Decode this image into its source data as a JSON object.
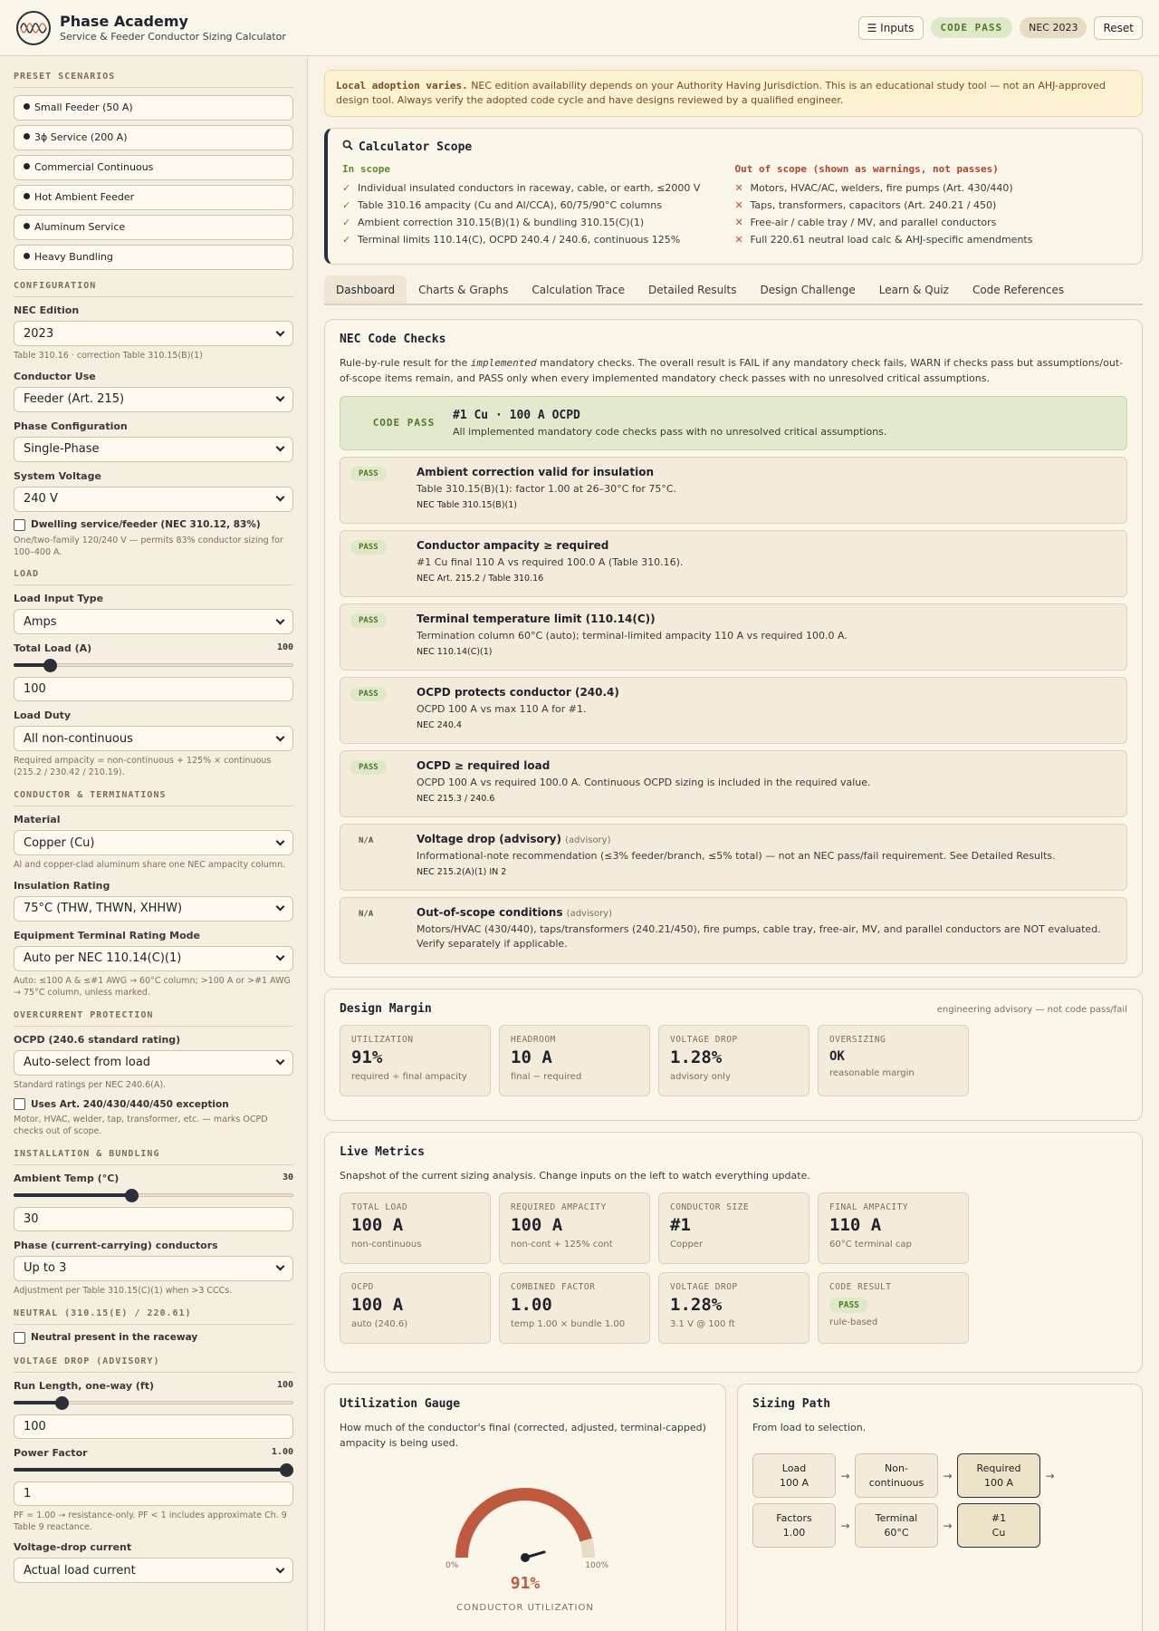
{
  "header": {
    "title": "Phase Academy",
    "subtitle": "Service & Feeder Conductor Sizing Calculator",
    "inputs_btn": "☰ Inputs",
    "code_pass": "CODE PASS",
    "nec": "NEC 2023",
    "reset": "Reset"
  },
  "sidebar": {
    "presets_h": "PRESET SCENARIOS",
    "presets": [
      "Small Feeder (50 A)",
      "3ϕ Service (200 A)",
      "Commercial Continuous",
      "Hot Ambient Feeder",
      "Aluminum Service",
      "Heavy Bundling"
    ],
    "config_h": "CONFIGURATION",
    "nec_edition_l": "NEC Edition",
    "nec_edition_v": "2023",
    "nec_edition_hint": "Table 310.16 · correction Table 310.15(B)(1)",
    "conductor_use_l": "Conductor Use",
    "conductor_use_v": "Feeder (Art. 215)",
    "phase_l": "Phase Configuration",
    "phase_v": "Single-Phase",
    "voltage_l": "System Voltage",
    "voltage_v": "240 V",
    "dwelling_l": "Dwelling service/feeder (NEC 310.12, 83%)",
    "dwelling_hint": "One/two-family 120/240 V — permits 83% conductor sizing for 100–400 A.",
    "load_h": "LOAD",
    "load_type_l": "Load Input Type",
    "load_type_v": "Amps",
    "total_load_l": "Total Load (A)",
    "total_load_val": "100",
    "total_load_slider": 0.13,
    "total_load_input": "100",
    "load_duty_l": "Load Duty",
    "load_duty_v": "All non-continuous",
    "load_duty_hint": "Required ampacity = non-continuous + 125% × continuous (215.2 / 230.42 / 210.19).",
    "cond_h": "CONDUCTOR & TERMINATIONS",
    "material_l": "Material",
    "material_v": "Copper (Cu)",
    "material_hint": "Al and copper-clad aluminum share one NEC ampacity column.",
    "insulation_l": "Insulation Rating",
    "insulation_v": "75°C (THW, THWN, XHHW)",
    "terminal_l": "Equipment Terminal Rating Mode",
    "terminal_v": "Auto per NEC 110.14(C)(1)",
    "terminal_hint": "Auto: ≤100 A & ≤#1 AWG → 60°C column; >100 A or >#1 AWG → 75°C column, unless marked.",
    "ocp_h": "OVERCURRENT PROTECTION",
    "ocpd_l": "OCPD (240.6 standard rating)",
    "ocpd_v": "Auto-select from load",
    "ocpd_hint": "Standard ratings per NEC 240.6(A).",
    "exception_l": "Uses Art. 240/430/440/450 exception",
    "exception_hint": "Motor, HVAC, welder, tap, transformer, etc. — marks OCPD checks out of scope.",
    "install_h": "INSTALLATION & BUNDLING",
    "ambient_l": "Ambient Temp (°C)",
    "ambient_val": "30",
    "ambient_slider": 0.42,
    "ambient_input": "30",
    "ccc_l": "Phase (current-carrying) conductors",
    "ccc_v": "Up to 3",
    "ccc_hint": "Adjustment per Table 310.15(C)(1) when >3 CCCs.",
    "neutral_h": "NEUTRAL (310.15(E) / 220.61)",
    "neutral_l": "Neutral present in the raceway",
    "vd_h": "VOLTAGE DROP (ADVISORY)",
    "run_l": "Run Length, one-way (ft)",
    "run_val": "100",
    "run_slider": 0.17,
    "run_input": "100",
    "pf_l": "Power Factor",
    "pf_val": "1.00",
    "pf_slider": 1.0,
    "pf_input": "1",
    "pf_hint": "PF = 1.00 → resistance-only. PF < 1 includes approximate Ch. 9 Table 9 reactance.",
    "vdc_l": "Voltage-drop current",
    "vdc_v": "Actual load current"
  },
  "banner": {
    "lead": "Local adoption varies.",
    "text": " NEC edition availability depends on your Authority Having Jurisdiction. This is an educational study tool — not an AHJ-approved design tool. Always verify the adopted code cycle and have designs reviewed by a qualified engineer."
  },
  "scope": {
    "title": "Calculator Scope",
    "in_h": "In scope",
    "in": [
      "Individual insulated conductors in raceway, cable, or earth, ≤2000 V",
      "Table 310.16 ampacity (Cu and Al/CCA), 60/75/90°C columns",
      "Ambient correction 310.15(B)(1) & bundling 310.15(C)(1)",
      "Terminal limits 110.14(C), OCPD 240.4 / 240.6, continuous 125%"
    ],
    "out_h": "Out of scope (shown as warnings, not passes)",
    "out": [
      "Motors, HVAC/AC, welders, fire pumps (Art. 430/440)",
      "Taps, transformers, capacitors (Art. 240.21 / 450)",
      "Free-air / cable tray / MV, and parallel conductors",
      "Full 220.61 neutral load calc & AHJ-specific amendments"
    ],
    "check": "✓",
    "cross": "✕"
  },
  "tabs": [
    "Dashboard",
    "Charts & Graphs",
    "Calculation Trace",
    "Detailed Results",
    "Design Challenge",
    "Learn & Quiz",
    "Code References"
  ],
  "checks": {
    "title": "NEC Code Checks",
    "desc_a": "Rule-by-rule result for the ",
    "desc_em": "implemented",
    "desc_b": " mandatory checks. The overall result is FAIL if any mandatory check fails, WARN if checks pass but assumptions/out-of-scope items remain, and PASS only when every implemented mandatory check passes with no unresolved critical assumptions.",
    "overall_tag": "CODE PASS",
    "overall_t1": "#1 Cu · 100 A OCPD",
    "overall_t2": "All implemented mandatory code checks pass with no unresolved critical assumptions.",
    "rows": [
      {
        "badge": "PASS",
        "title": "Ambient correction valid for insulation",
        "adv": "",
        "detail": "Table 310.15(B)(1): factor 1.00 at 26–30°C for 75°C.",
        "ref": "NEC Table 310.15(B)(1)"
      },
      {
        "badge": "PASS",
        "title": "Conductor ampacity ≥ required",
        "adv": "",
        "detail": "#1 Cu final 110 A vs required 100.0 A (Table 310.16).",
        "ref": "NEC Art. 215.2 / Table 310.16"
      },
      {
        "badge": "PASS",
        "title": "Terminal temperature limit (110.14(C))",
        "adv": "",
        "detail": "Termination column 60°C (auto); terminal-limited ampacity 110 A vs required 100.0 A.",
        "ref": "NEC 110.14(C)(1)"
      },
      {
        "badge": "PASS",
        "title": "OCPD protects conductor (240.4)",
        "adv": "",
        "detail": "OCPD 100 A vs max 110 A for #1.",
        "ref": "NEC 240.4"
      },
      {
        "badge": "PASS",
        "title": "OCPD ≥ required load",
        "adv": "",
        "detail": "OCPD 100 A vs required 100.0 A. Continuous OCPD sizing is included in the required value.",
        "ref": "NEC 215.3 / 240.6"
      },
      {
        "badge": "N/A",
        "title": "Voltage drop (advisory)",
        "adv": "(advisory)",
        "detail": "Informational-note recommendation (≤3% feeder/branch, ≤5% total) — not an NEC pass/fail requirement. See Detailed Results.",
        "ref": "NEC 215.2(A)(1) IN 2"
      },
      {
        "badge": "N/A",
        "title": "Out-of-scope conditions",
        "adv": "(advisory)",
        "detail": "Motors/HVAC (430/440), taps/transformers (240.21/450), fire pumps, cable tray, free-air, MV, and parallel conductors are NOT evaluated. Verify separately if applicable.",
        "ref": ""
      }
    ]
  },
  "margin": {
    "title": "Design Margin",
    "note": "engineering advisory — not code pass/fail",
    "tiles": [
      {
        "label": "UTILIZATION",
        "value": "91%",
        "sub": "required ÷ final ampacity"
      },
      {
        "label": "HEADROOM",
        "value": "10 A",
        "sub": "final − required"
      },
      {
        "label": "VOLTAGE DROP",
        "value": "1.28%",
        "sub": "advisory only"
      },
      {
        "label": "OVERSIZING",
        "value": "OK",
        "sub": "reasonable margin"
      }
    ]
  },
  "live": {
    "title": "Live Metrics",
    "desc": "Snapshot of the current sizing analysis. Change inputs on the left to watch everything update.",
    "tiles": [
      {
        "label": "TOTAL LOAD",
        "value": "100 A",
        "sub": "non-continuous"
      },
      {
        "label": "REQUIRED AMPACITY",
        "value": "100 A",
        "sub": "non-cont + 125% cont"
      },
      {
        "label": "CONDUCTOR SIZE",
        "value": "#1",
        "sub": "Copper"
      },
      {
        "label": "FINAL AMPACITY",
        "value": "110 A",
        "sub": "60°C terminal cap"
      },
      {
        "label": "OCPD",
        "value": "100 A",
        "sub": "auto (240.6)"
      },
      {
        "label": "COMBINED FACTOR",
        "value": "1.00",
        "sub": "temp 1.00 × bundle 1.00"
      },
      {
        "label": "VOLTAGE DROP",
        "value": "1.28%",
        "sub": "3.1 V @ 100 ft"
      },
      {
        "label": "CODE RESULT",
        "badge": "PASS",
        "sub": "rule-based"
      }
    ]
  },
  "gauge": {
    "title": "Utilization Gauge",
    "desc": "How much of the conductor's final (corrected, adjusted, terminal-capped) ampacity is being used.",
    "min": "0%",
    "max": "100%",
    "value": "91%",
    "fraction": 0.91,
    "label": "CONDUCTOR UTILIZATION",
    "color": "#c05a3f"
  },
  "path": {
    "title": "Sizing Path",
    "desc": "From load to selection.",
    "row1": [
      [
        "Load",
        "100 A"
      ],
      [
        "Non-",
        "continuous"
      ],
      [
        "Required",
        "100 A"
      ]
    ],
    "row2": [
      [
        "Factors",
        "1.00"
      ],
      [
        "Terminal",
        "60°C"
      ],
      [
        "#1",
        "Cu"
      ]
    ],
    "arrow": "→"
  }
}
